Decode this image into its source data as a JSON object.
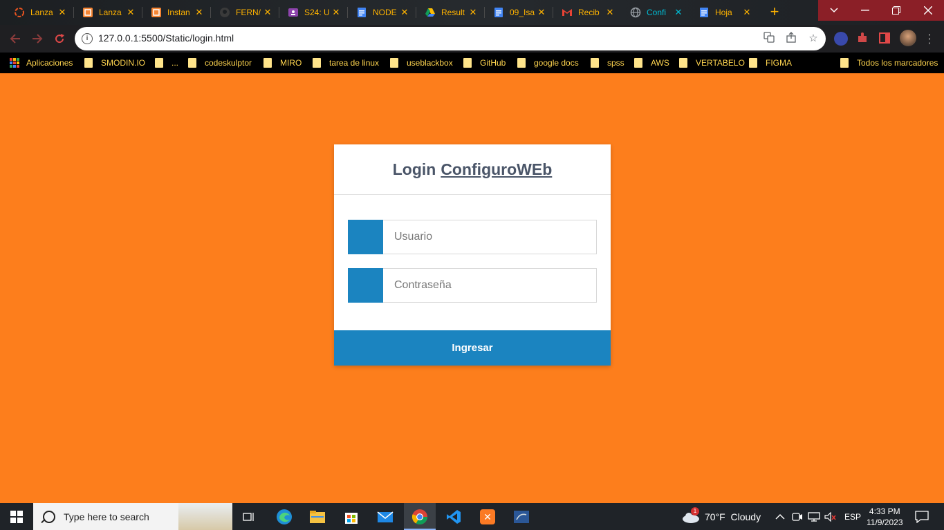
{
  "browser": {
    "tabs": [
      {
        "label": "Lanza",
        "icon": "ubuntu-icon",
        "color": "#e95420",
        "active": false
      },
      {
        "label": "Lanza",
        "icon": "aws-icon",
        "color": "#f58534",
        "active": false
      },
      {
        "label": "Instan",
        "icon": "aws-icon",
        "color": "#f58534",
        "active": false
      },
      {
        "label": "FERN/",
        "icon": "github-icon",
        "color": "#333333",
        "active": false
      },
      {
        "label": "S24: U",
        "icon": "classroom-icon",
        "color": "#8e44ad",
        "active": false
      },
      {
        "label": "NODE",
        "icon": "docs-icon",
        "color": "#4285f4",
        "active": false
      },
      {
        "label": "Result",
        "icon": "drive-icon",
        "color": "#0f9d58",
        "active": false
      },
      {
        "label": "09_Isa",
        "icon": "docs-icon",
        "color": "#4285f4",
        "active": false
      },
      {
        "label": "Recib",
        "icon": "gmail-icon",
        "color": "#ea4335",
        "active": false
      },
      {
        "label": "Confi",
        "icon": "globe-icon",
        "color": "#9aa0a6",
        "active": true
      },
      {
        "label": "Hoja",
        "icon": "docs-icon",
        "color": "#4285f4",
        "active": false
      }
    ],
    "new_tab": "+",
    "url": "127.0.0.1:5500/Static/login.html",
    "bookmarks": {
      "apps": "Aplicaciones",
      "items": [
        "SMODIN.IO",
        "...",
        "codeskulptor",
        "MIRO",
        "tarea de linux",
        "useblackbox",
        "GitHub",
        "google docs",
        "spss",
        "AWS",
        "VERTABELO",
        "FIGMA"
      ],
      "all": "Todos los marcadores"
    }
  },
  "login": {
    "title_prefix": "Login",
    "title_brand": "ConfiguroWEb",
    "username_placeholder": "Usuario",
    "password_placeholder": "Contraseña",
    "submit_label": "Ingresar",
    "colors": {
      "page_bg": "#fd7e1c",
      "accent": "#1b84c0",
      "title": "#4a5568"
    }
  },
  "taskbar": {
    "search_placeholder": "Type here to search",
    "weather": "70°F  Cloudy",
    "language": "ESP",
    "time": "4:33 PM",
    "date": "11/9/2023",
    "weather_badge": "1"
  }
}
